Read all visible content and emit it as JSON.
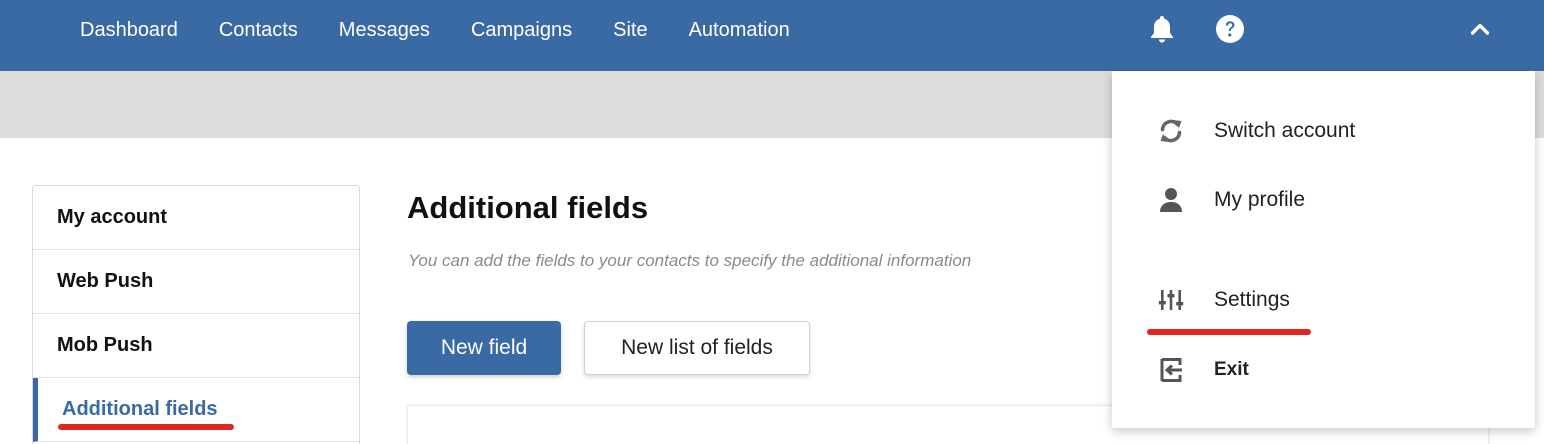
{
  "nav": {
    "items": [
      "Dashboard",
      "Contacts",
      "Messages",
      "Campaigns",
      "Site",
      "Automation"
    ]
  },
  "header_icons": [
    "bell-icon",
    "help-icon",
    "chevron-up-icon"
  ],
  "sidebar": {
    "items": [
      {
        "label": "My account",
        "active": false
      },
      {
        "label": "Web Push",
        "active": false
      },
      {
        "label": "Mob Push",
        "active": false
      },
      {
        "label": "Additional fields",
        "active": true
      }
    ]
  },
  "main": {
    "title": "Additional fields",
    "subtitle": "You can add the fields to your contacts to specify the additional information",
    "new_field_label": "New field",
    "new_list_label": "New list of fields"
  },
  "dropdown": {
    "items": [
      {
        "label": "Switch account",
        "icon": "refresh-icon"
      },
      {
        "label": "My profile",
        "icon": "user-icon"
      },
      {
        "label": "Settings",
        "icon": "sliders-icon"
      },
      {
        "label": "Exit",
        "icon": "exit-icon"
      }
    ]
  },
  "colors": {
    "header": "#3a6aa3",
    "accent": "#3a6aa3",
    "highlight_underline": "#e2251f"
  }
}
